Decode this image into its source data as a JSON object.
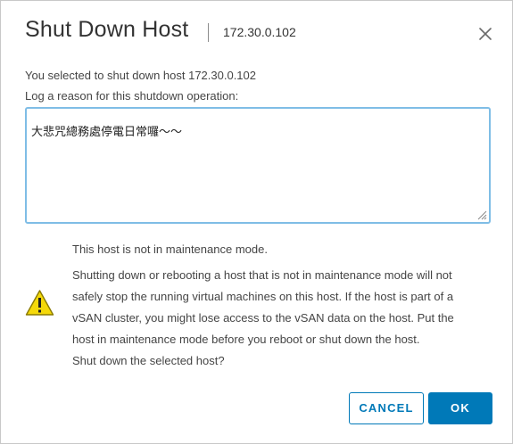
{
  "dialog": {
    "title": "Shut Down Host",
    "host": "172.30.0.102",
    "close_icon": "close-icon"
  },
  "form": {
    "selected_text": "You selected to shut down host 172.30.0.102",
    "reason_label": "Log a reason for this shutdown operation:",
    "reason_value": "大悲咒總務處停電日常囉～～"
  },
  "warning": {
    "icon": "warning-icon",
    "status": "This host is not in maintenance mode.",
    "lines": [
      "Shutting down or rebooting a host that is not in maintenance mode will not",
      "safely stop the running virtual machines on this host. If the host is part of a",
      "vSAN cluster, you might lose access to the vSAN data on the host. Put the",
      "host in maintenance mode before you reboot or shut down the host."
    ],
    "question": "Shut down the selected host?"
  },
  "buttons": {
    "cancel_label": "CANCEL",
    "ok_label": "OK"
  },
  "colors": {
    "primary": "#0079b8",
    "focus_border": "#7fbde6",
    "warning_yellow": "#f5d90a"
  }
}
